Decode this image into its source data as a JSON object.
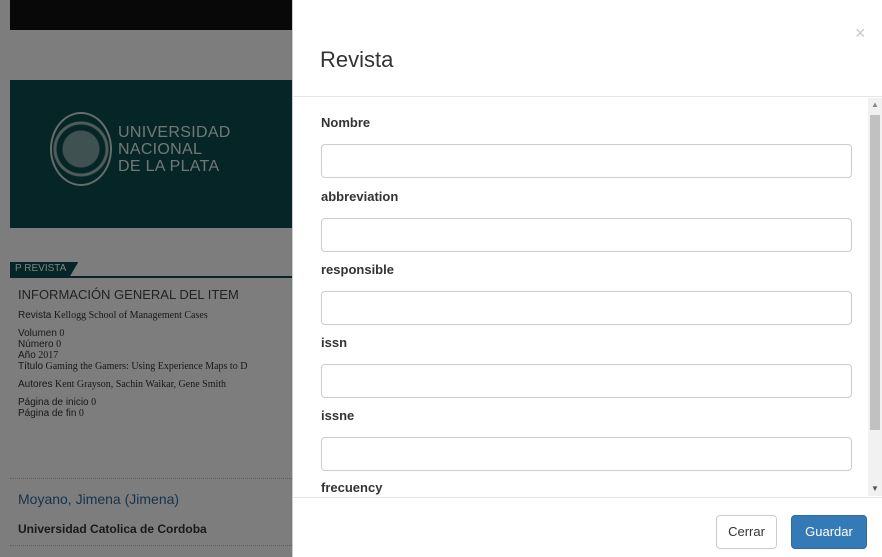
{
  "background": {
    "university": {
      "line1": "UNIVERSIDAD",
      "line2": "NACIONAL",
      "line3": "DE LA PLATA"
    },
    "tab_label": "P  REVISTA",
    "info_heading": "INFORMACIÓN GENERAL DEL ITEM",
    "fields": [
      {
        "key": "Revista",
        "value": "Kellogg School of Management Cases"
      },
      {
        "key": "Volumen",
        "value": "0"
      },
      {
        "key": "Número",
        "value": "0"
      },
      {
        "key": "Año",
        "value": "2017"
      },
      {
        "key": "Título",
        "value": "Gaming the Gamers: Using Experience Maps to D"
      },
      {
        "key": "Autores",
        "value": "Kent Grayson, Sachin Waikar, Gene Smith"
      },
      {
        "key": "Página de inicio",
        "value": "0"
      },
      {
        "key": "Página de fin",
        "value": "0"
      }
    ],
    "person": "Moyano, Jimena (Jimena)",
    "organization": "Universidad Catolica de Cordoba"
  },
  "modal": {
    "title": "Revista",
    "close_symbol": "×",
    "fields": [
      {
        "label": "Nombre",
        "value": ""
      },
      {
        "label": "abbreviation",
        "value": ""
      },
      {
        "label": "responsible",
        "value": ""
      },
      {
        "label": "issn",
        "value": ""
      },
      {
        "label": "issne",
        "value": ""
      },
      {
        "label": "frecuency",
        "value": ""
      }
    ],
    "buttons": {
      "cancel": "Cerrar",
      "save": "Guardar"
    }
  },
  "colors": {
    "brand": "#0a4b4e",
    "primary": "#337ab7",
    "link": "#2a6a9a"
  }
}
